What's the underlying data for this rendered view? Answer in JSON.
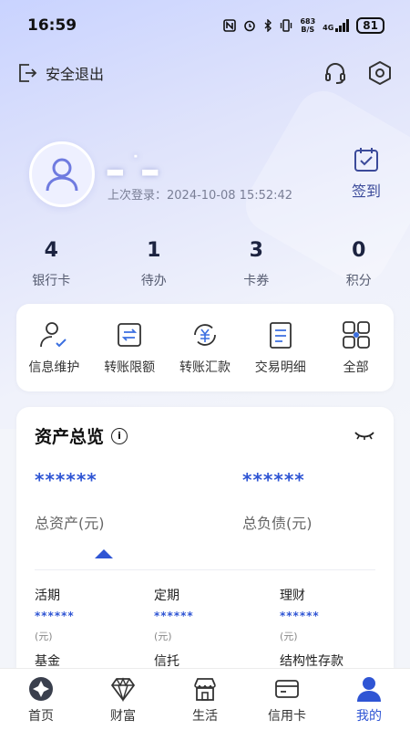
{
  "status_bar": {
    "time": "16:59",
    "net_speed_top": "683",
    "net_speed_bottom": "B/S",
    "network": "4G",
    "battery": "81"
  },
  "top_bar": {
    "logout_label": "安全退出"
  },
  "profile": {
    "name": "▂ ˙▂",
    "last_login": "上次登录：2024-10-08 15:52:42",
    "signin_label": "签到"
  },
  "stats": [
    {
      "value": "4",
      "label": "银行卡"
    },
    {
      "value": "1",
      "label": "待办"
    },
    {
      "value": "3",
      "label": "卡券"
    },
    {
      "value": "0",
      "label": "积分"
    }
  ],
  "quick_actions": [
    {
      "label": "信息维护",
      "icon": "user-edit-icon"
    },
    {
      "label": "转账限额",
      "icon": "transfer-limit-icon"
    },
    {
      "label": "转账汇款",
      "icon": "yuan-exchange-icon"
    },
    {
      "label": "交易明细",
      "icon": "document-list-icon"
    },
    {
      "label": "全部",
      "icon": "grid-icon"
    }
  ],
  "asset": {
    "title": "资产总览",
    "total_assets_value": "******",
    "total_assets_label": "总资产(元)",
    "total_liabilities_value": "******",
    "total_liabilities_label": "总负债(元)",
    "items": [
      {
        "name": "活期",
        "value": "******",
        "unit": "(元)"
      },
      {
        "name": "定期",
        "value": "******",
        "unit": "(元)"
      },
      {
        "name": "理财",
        "value": "******",
        "unit": "(元)"
      },
      {
        "name": "基金"
      },
      {
        "name": "信托"
      },
      {
        "name": "结构性存款"
      }
    ]
  },
  "bottom_nav": [
    {
      "label": "首页",
      "icon": "home-icon",
      "active": false
    },
    {
      "label": "财富",
      "icon": "diamond-icon",
      "active": false
    },
    {
      "label": "生活",
      "icon": "store-icon",
      "active": false
    },
    {
      "label": "信用卡",
      "icon": "credit-card-icon",
      "active": false
    },
    {
      "label": "我的",
      "icon": "person-icon",
      "active": true
    }
  ],
  "colors": {
    "accent": "#2f55d4",
    "header_gradient_start": "#c9d3ff"
  }
}
